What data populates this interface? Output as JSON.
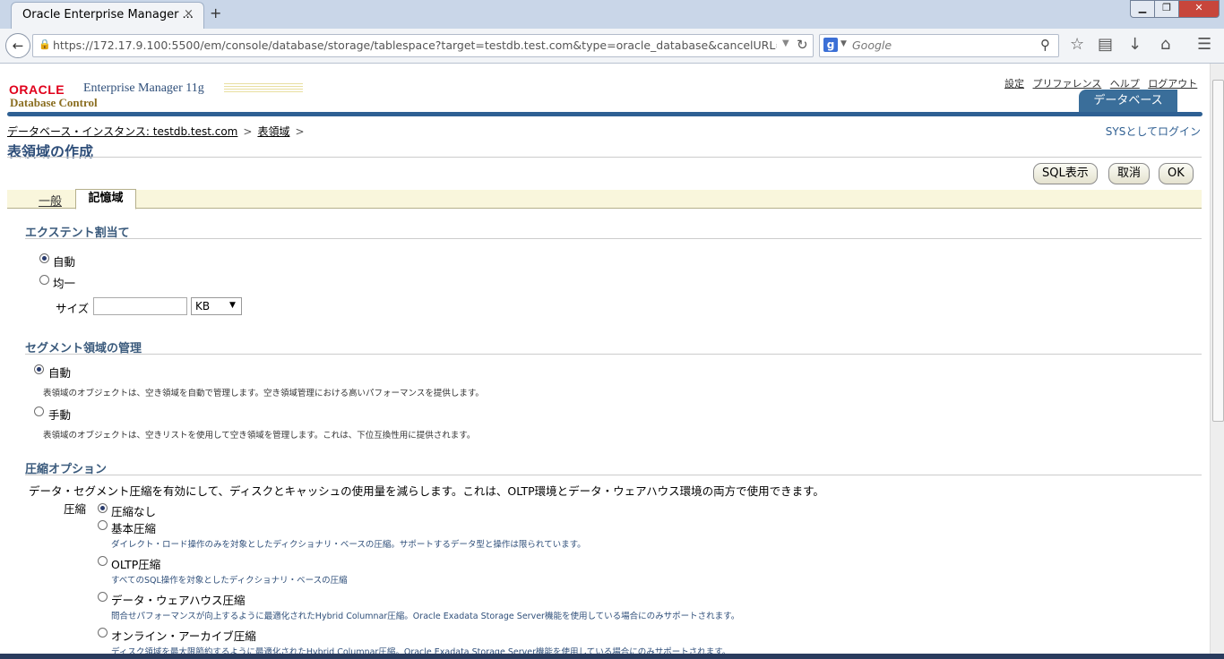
{
  "browser": {
    "tab_title": "Oracle Enterprise Manager ...",
    "tab_close": "×",
    "new_tab": "+",
    "url": "https://172.17.9.100:5500/em/console/database/storage/tablespace?target=testdb.test.com&type=oracle_database&cancelURL=/em/cc",
    "search_placeholder": "Google",
    "window_buttons": {
      "minimize": "▁",
      "maximize": "❐",
      "close": "✕"
    }
  },
  "header": {
    "logo_oracle": "ORACLE",
    "logo_em": "Enterprise Manager 11g",
    "logo_sub": "Database Control",
    "global_links": [
      "設定",
      "プリファレンス",
      "ヘルプ",
      "ログアウト"
    ],
    "db_tab": "データベース",
    "login_as": "SYSとしてログイン"
  },
  "breadcrumb": {
    "items": [
      "データベース・インスタンス: testdb.test.com",
      "表領域"
    ],
    "separator": ">"
  },
  "page_title": "表領域の作成",
  "buttons": {
    "show_sql": "SQL表示",
    "cancel": "取消",
    "ok": "OK"
  },
  "subtabs": {
    "general": "一般",
    "storage": "記憶域"
  },
  "extent": {
    "title": "エクステント割当て",
    "auto": "自動",
    "uniform": "均一",
    "size_label": "サイズ",
    "size_value": "",
    "unit": "KB"
  },
  "segment": {
    "title": "セグメント領域の管理",
    "auto": "自動",
    "auto_desc": "表領域のオブジェクトは、空き領域を自動で管理します。空き領域管理における高いパフォーマンスを提供します。",
    "manual": "手動",
    "manual_desc": "表領域のオブジェクトは、空きリストを使用して空き領域を管理します。これは、下位互換性用に提供されます。"
  },
  "compression": {
    "title": "圧縮オプション",
    "intro": "データ・セグメント圧縮を有効にして、ディスクとキャッシュの使用量を減らします。これは、OLTP環境とデータ・ウェアハウス環境の両方で使用できます。",
    "label": "圧縮",
    "options": [
      {
        "label": "圧縮なし",
        "desc": ""
      },
      {
        "label": "基本圧縮",
        "desc": "ダイレクト・ロード操作のみを対象としたディクショナリ・ベースの圧縮。サポートするデータ型と操作は限られています。"
      },
      {
        "label": "OLTP圧縮",
        "desc": "すべてのSQL操作を対象としたディクショナリ・ベースの圧縮"
      },
      {
        "label": "データ・ウェアハウス圧縮",
        "desc": "問合せパフォーマンスが向上するように最適化されたHybrid Columnar圧縮。Oracle Exadata Storage Server機能を使用している場合にのみサポートされます。"
      },
      {
        "label": "オンライン・アーカイブ圧縮",
        "desc": "ディスク領域を最大限節約するように最適化されたHybrid Columnar圧縮。Oracle Exadata Storage Server機能を使用している場合にのみサポートされます。"
      }
    ]
  }
}
